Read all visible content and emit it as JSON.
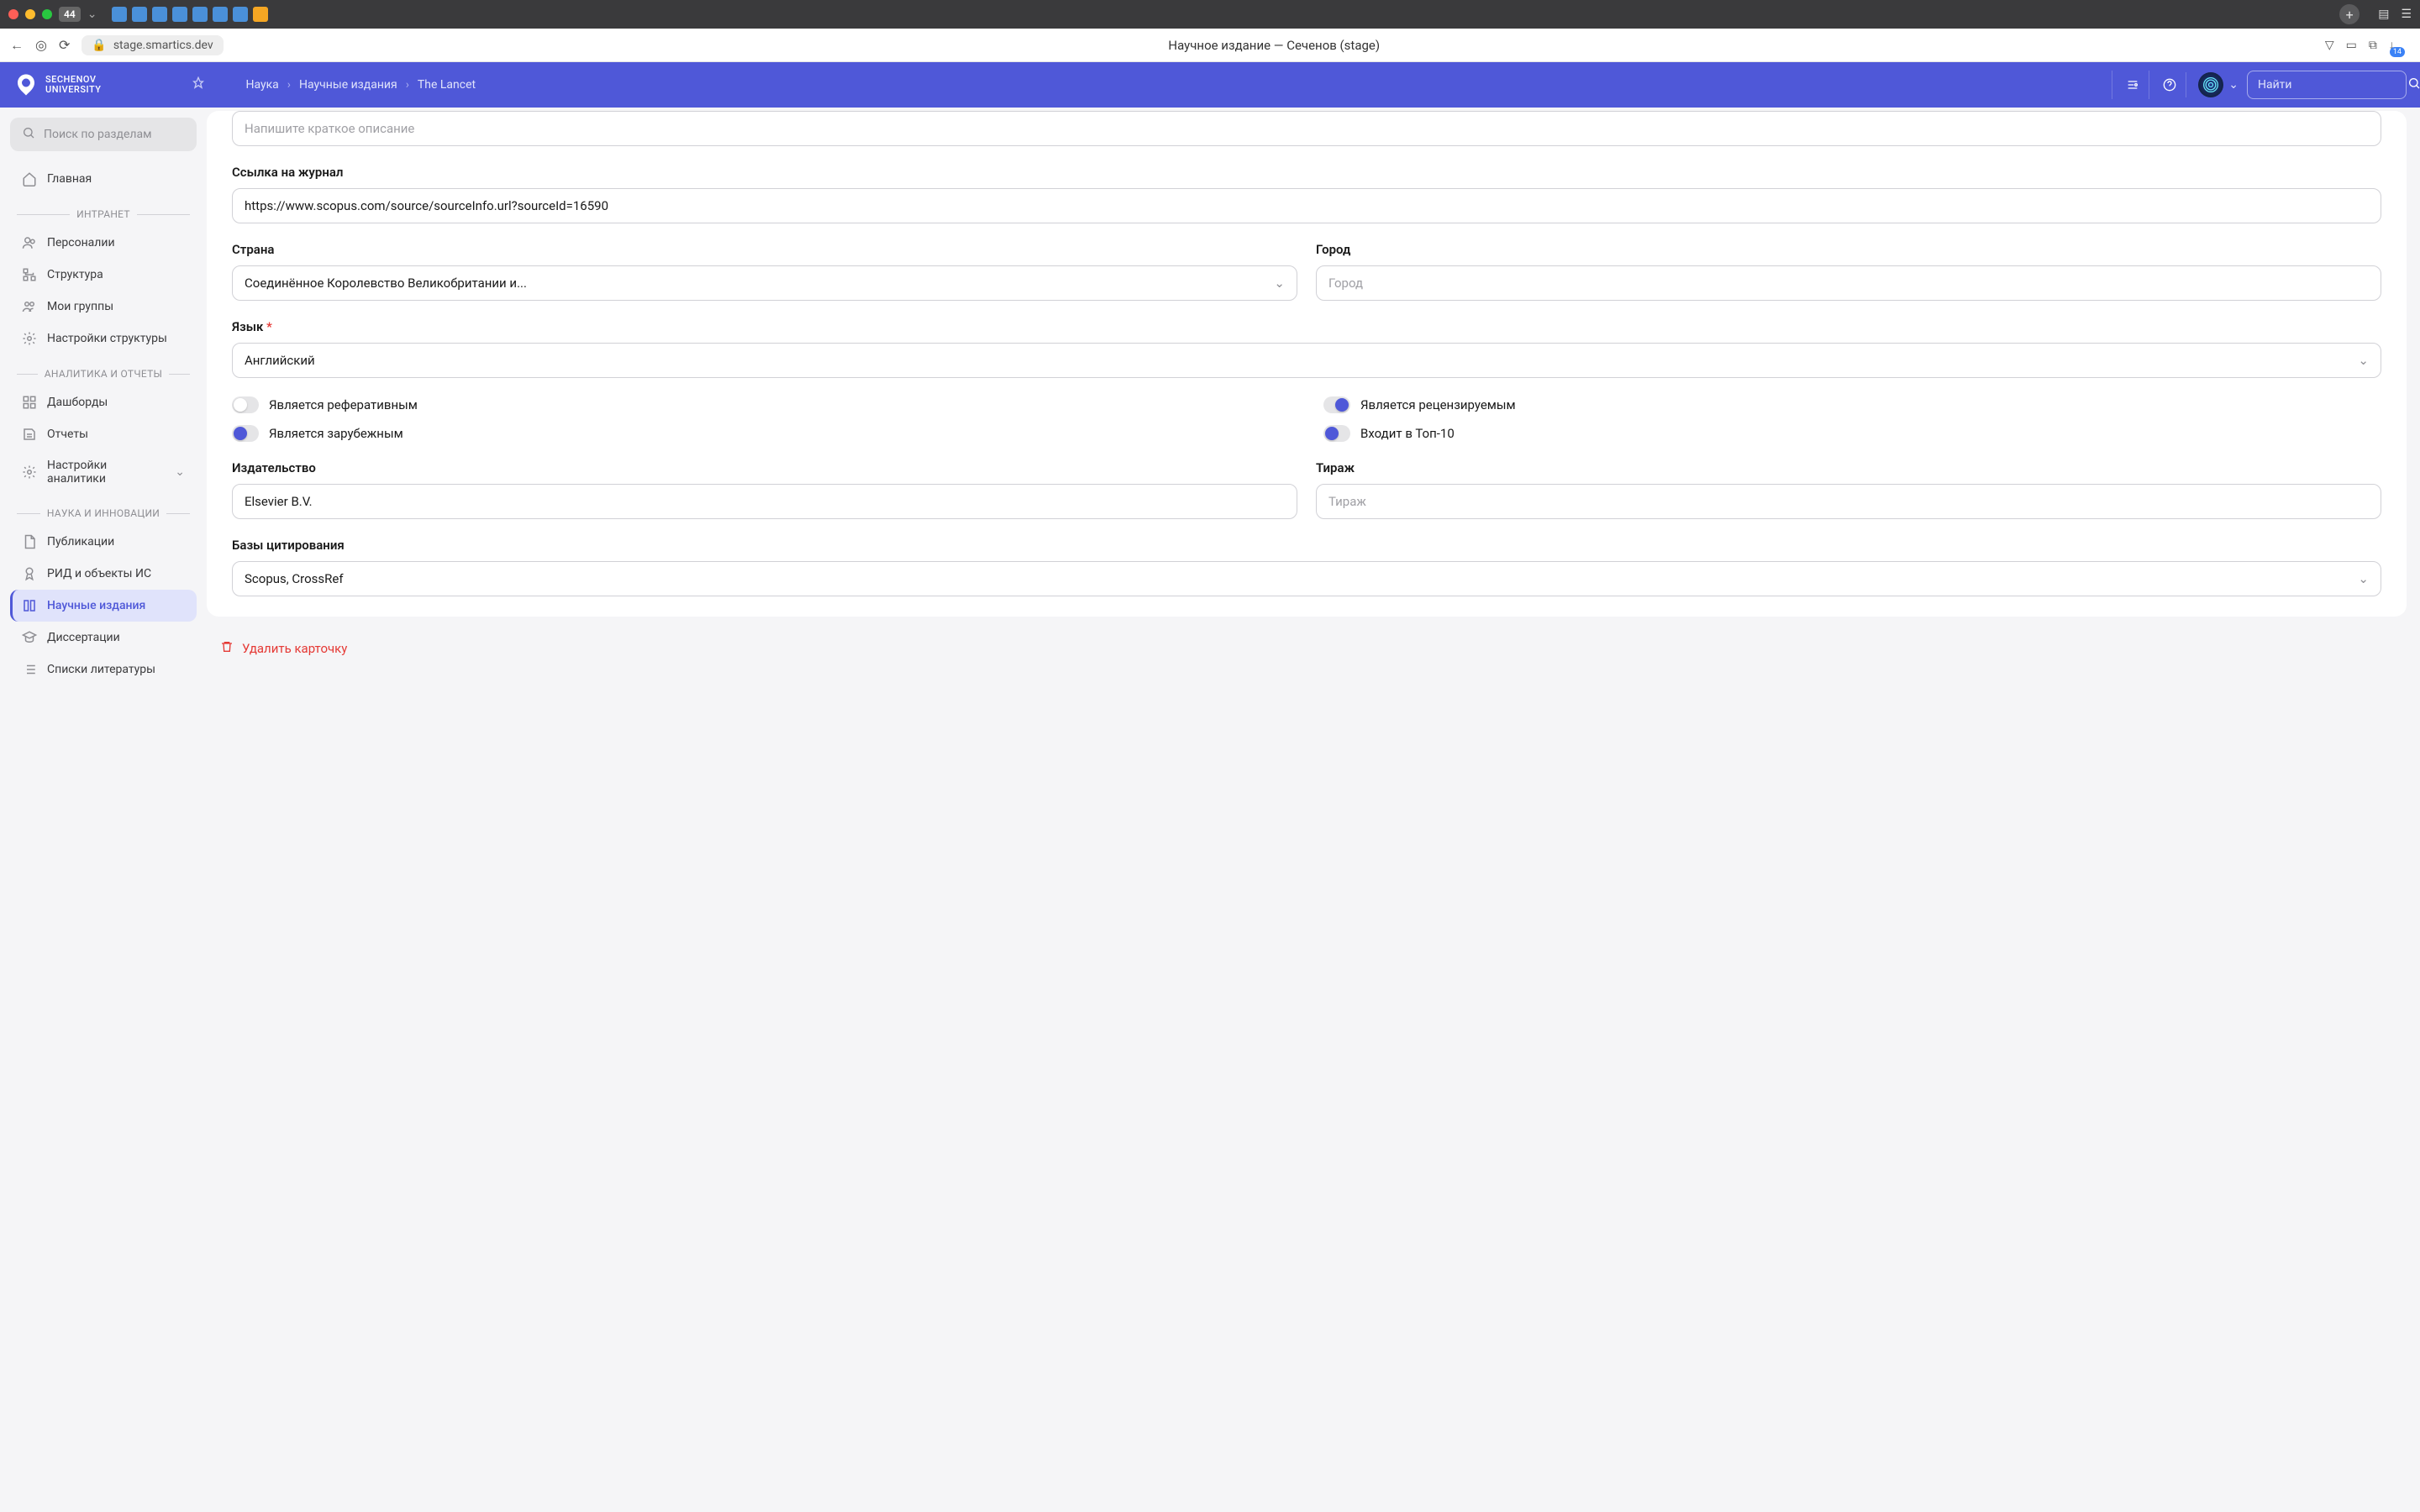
{
  "browser": {
    "url": "stage.smartics.dev",
    "title": "Научное издание — Сеченов (stage)",
    "mac_badge": "44",
    "notif_count": "14"
  },
  "header": {
    "logo_line1": "SECHENOV",
    "logo_line2": "UNIVERSITY",
    "breadcrumb": [
      "Наука",
      "Научные издания",
      "The Lancet"
    ],
    "search_placeholder": "Найти"
  },
  "sidebar": {
    "search_placeholder": "Поиск по разделам",
    "items": [
      {
        "label": "Главная",
        "icon": "home"
      }
    ],
    "sections": [
      {
        "title": "ИНТРАНЕТ",
        "items": [
          {
            "label": "Персоналии",
            "icon": "users"
          },
          {
            "label": "Структура",
            "icon": "sitemap"
          },
          {
            "label": "Мои группы",
            "icon": "groups"
          },
          {
            "label": "Настройки структуры",
            "icon": "gear"
          }
        ]
      },
      {
        "title": "АНАЛИТИКА И ОТЧЕТЫ",
        "items": [
          {
            "label": "Дашборды",
            "icon": "dashboard"
          },
          {
            "label": "Отчеты",
            "icon": "report"
          },
          {
            "label": "Настройки аналитики",
            "icon": "gear",
            "chevron": true
          }
        ]
      },
      {
        "title": "НАУКА И ИННОВАЦИИ",
        "items": [
          {
            "label": "Публикации",
            "icon": "doc"
          },
          {
            "label": "РИД и объекты ИС",
            "icon": "award"
          },
          {
            "label": "Научные издания",
            "icon": "journal",
            "active": true
          },
          {
            "label": "Диссертации",
            "icon": "grad"
          },
          {
            "label": "Списки литературы",
            "icon": "list"
          }
        ]
      }
    ]
  },
  "form": {
    "description_placeholder": "Напишите краткое описание",
    "link_label": "Ссылка на журнал",
    "link_value": "https://www.scopus.com/source/sourceInfo.url?sourceId=16590",
    "country_label": "Страна",
    "country_value": "Соединённое Королевство Великобритании и...",
    "city_label": "Город",
    "city_placeholder": "Город",
    "language_label": "Язык",
    "language_value": "Английский",
    "toggles": {
      "ref": {
        "label": "Является реферативным",
        "on": false
      },
      "peer": {
        "label": "Является рецензируемым",
        "on": true
      },
      "foreign": {
        "label": "Является зарубежным",
        "on": true
      },
      "top10": {
        "label": "Входит в Топ-10",
        "on": true
      }
    },
    "publisher_label": "Издательство",
    "publisher_value": "Elsevier B.V.",
    "circulation_label": "Тираж",
    "circulation_placeholder": "Тираж",
    "citation_label": "Базы цитирования",
    "citation_value": "Scopus, CrossRef"
  },
  "delete_label": "Удалить карточку"
}
